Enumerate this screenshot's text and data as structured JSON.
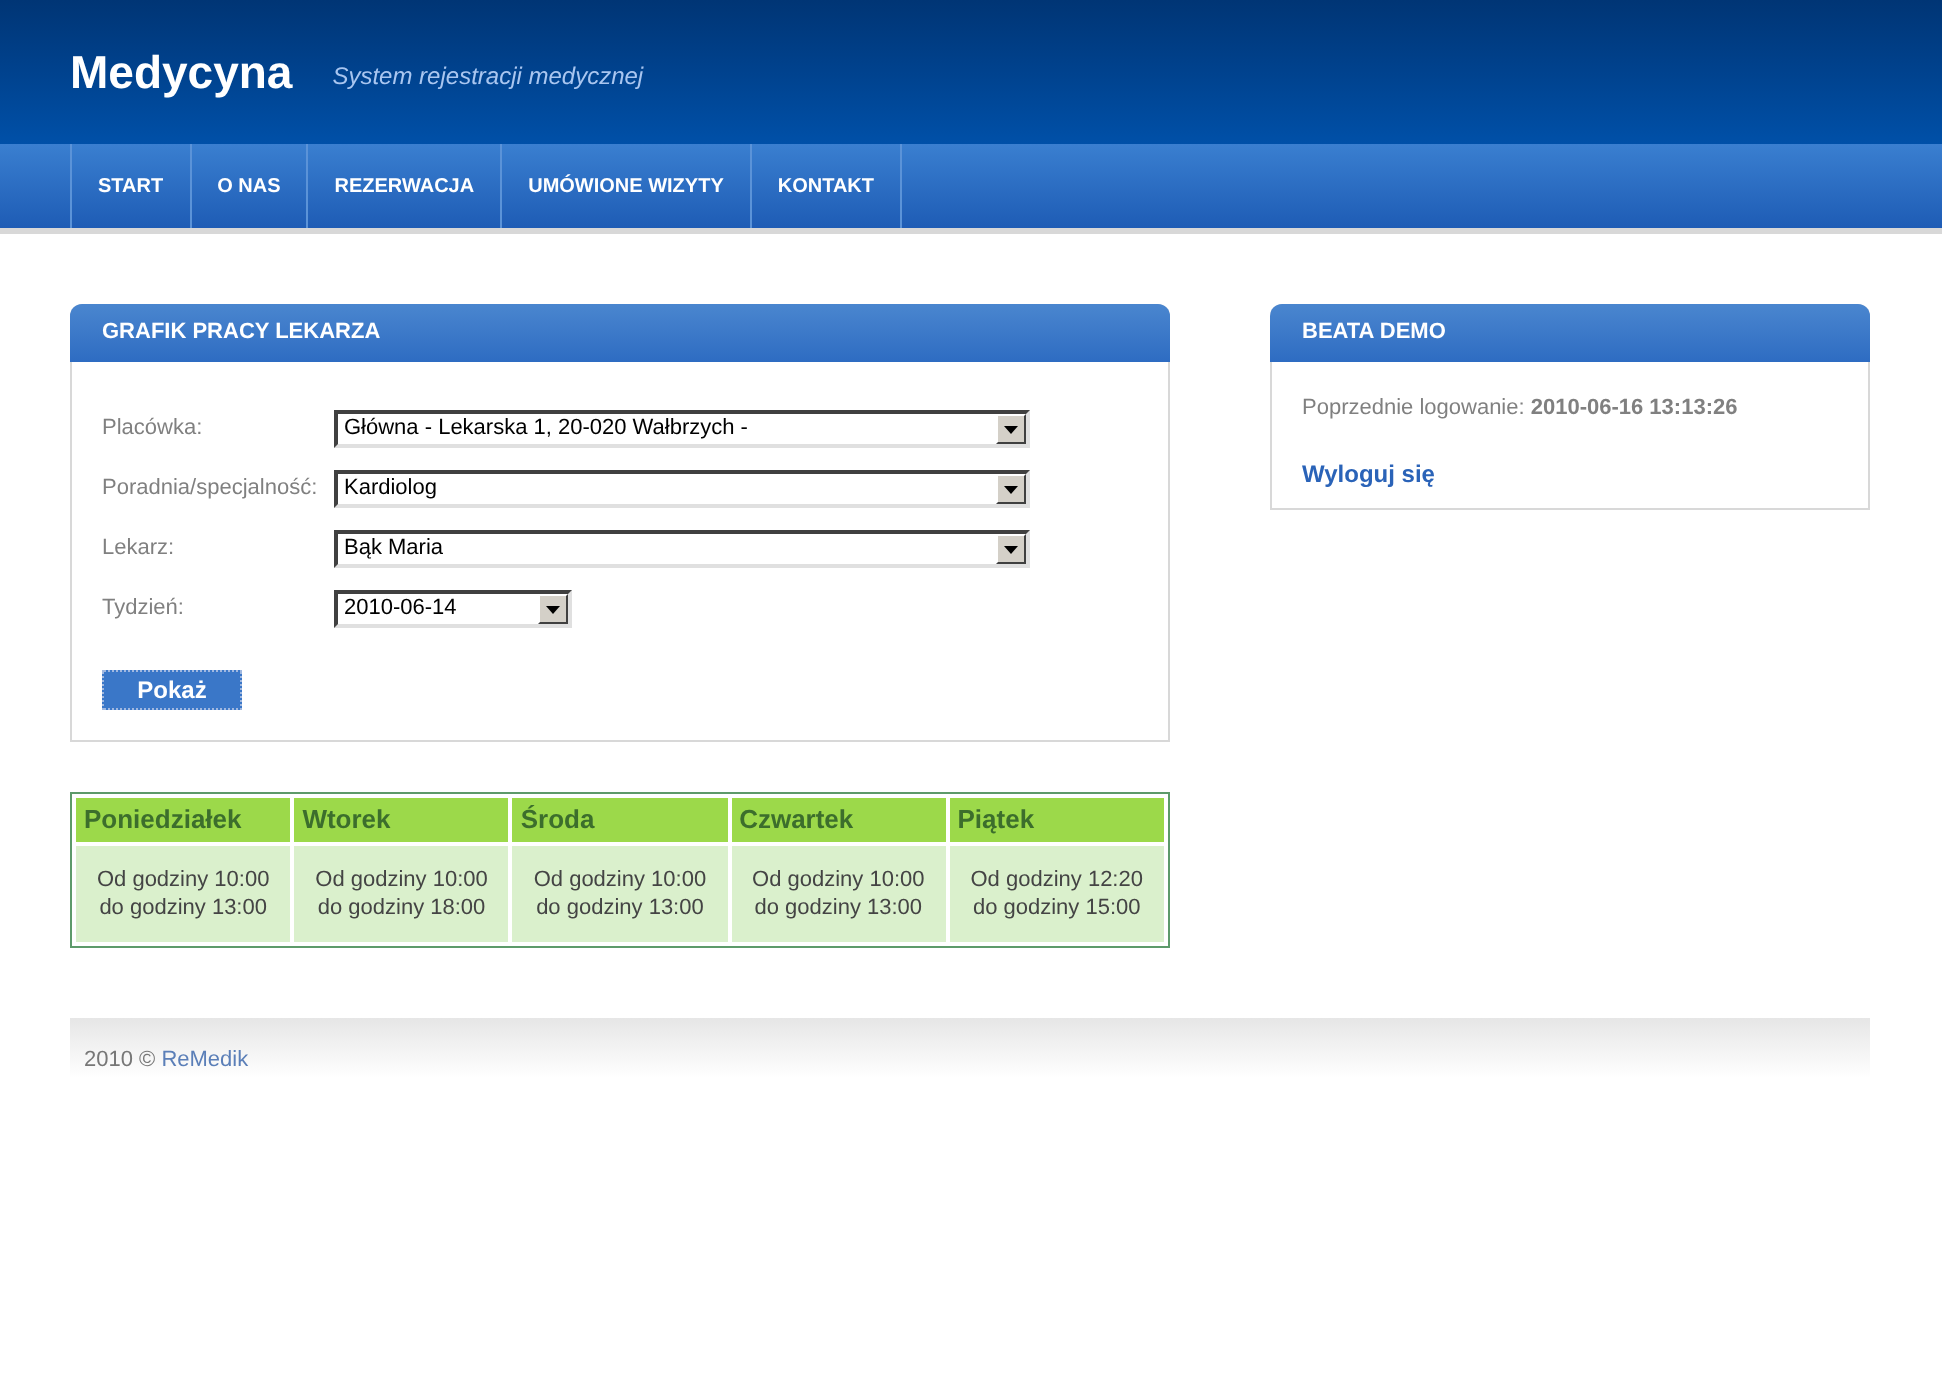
{
  "header": {
    "logo": "Medycyna",
    "tagline": "System rejestracji medycznej"
  },
  "nav": [
    {
      "label": "START"
    },
    {
      "label": "O NAS"
    },
    {
      "label": "REZERWACJA"
    },
    {
      "label": "UMÓWIONE WIZYTY"
    },
    {
      "label": "KONTAKT"
    }
  ],
  "schedule_panel": {
    "title": "GRAFIK PRACY LEKARZA",
    "fields": [
      {
        "label": "Placówka:",
        "value": "Główna - Lekarska 1, 20-020 Wałbrzych -",
        "wide": true
      },
      {
        "label": "Poradnia/specjalność:",
        "value": "Kardiolog",
        "wide": true
      },
      {
        "label": "Lekarz:",
        "value": "Bąk Maria",
        "wide": true
      },
      {
        "label": "Tydzień:",
        "value": "2010-06-14",
        "wide": false
      }
    ],
    "button": "Pokaż"
  },
  "schedule": [
    {
      "day": "Poniedziałek",
      "hours": "Od godziny 10:00\ndo godziny 13:00"
    },
    {
      "day": "Wtorek",
      "hours": "Od godziny 10:00\ndo godziny 18:00"
    },
    {
      "day": "Środa",
      "hours": "Od godziny 10:00\ndo godziny 13:00"
    },
    {
      "day": "Czwartek",
      "hours": "Od godziny 10:00\ndo godziny 13:00"
    },
    {
      "day": "Piątek",
      "hours": "Od godziny 12:20\ndo godziny 15:00"
    }
  ],
  "user_panel": {
    "title": "BEATA DEMO",
    "last_login_label": "Poprzednie logowanie:",
    "last_login": "2010-06-16 13:13:26",
    "logout": "Wyloguj się"
  },
  "footer": {
    "text": "2010 ©",
    "link": "ReMedik"
  }
}
